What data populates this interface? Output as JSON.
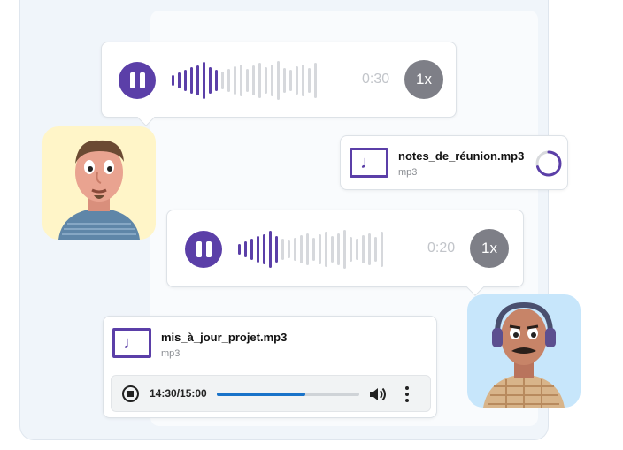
{
  "voice_message_1": {
    "time": "0:30",
    "speed": "1x",
    "played_bars": 8
  },
  "file_message_1": {
    "name": "notes_de_réunion.mp3",
    "type": "mp3",
    "icon": "music-note-icon",
    "loading_progress": 0.7
  },
  "voice_message_2": {
    "time": "0:20",
    "speed": "1x",
    "played_bars": 7
  },
  "file_message_2": {
    "name": "mis_à_jour_projet.mp3",
    "type": "mp3",
    "icon": "music-note-icon",
    "player": {
      "time": "14:30/15:00",
      "progress": 0.62
    }
  },
  "colors": {
    "accent": "#5b3fa8",
    "played_wave": "#5b3fa8",
    "unplayed_wave": "#d6d8dc",
    "progress": "#1a73c9"
  }
}
